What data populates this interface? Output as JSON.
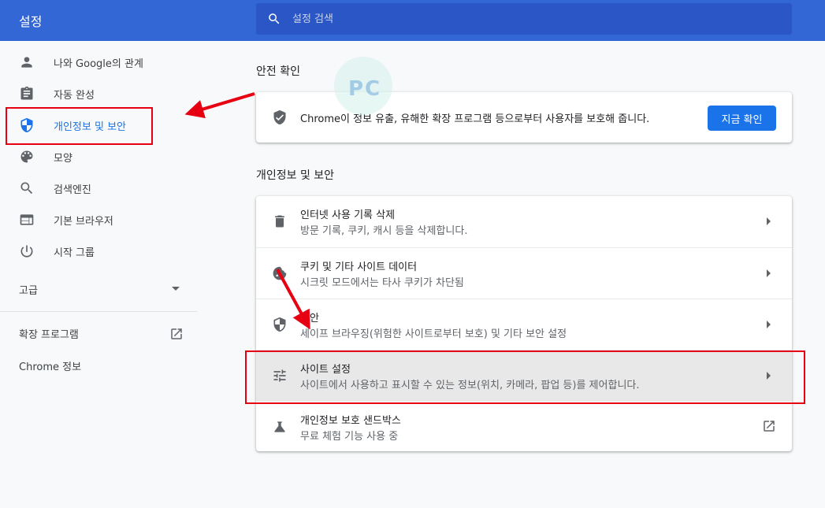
{
  "header": {
    "title": "설정",
    "search_placeholder": "설정 검색"
  },
  "sidebar": {
    "items": [
      {
        "label": "나와 Google의 관계",
        "icon": "person-icon"
      },
      {
        "label": "자동 완성",
        "icon": "clipboard-icon"
      },
      {
        "label": "개인정보 및 보안",
        "icon": "shield-icon",
        "active": true
      },
      {
        "label": "모양",
        "icon": "palette-icon"
      },
      {
        "label": "검색엔진",
        "icon": "search-icon"
      },
      {
        "label": "기본 브라우저",
        "icon": "browser-icon"
      },
      {
        "label": "시작 그룹",
        "icon": "power-icon"
      }
    ],
    "advanced_label": "고급",
    "extensions_label": "확장 프로그램",
    "about_label": "Chrome 정보"
  },
  "safety_check": {
    "section_title": "안전 확인",
    "description": "Chrome이 정보 유출, 유해한 확장 프로그램 등으로부터 사용자를 보호해 줍니다.",
    "button_label": "지금 확인"
  },
  "privacy": {
    "section_title": "개인정보 및 보안",
    "rows": [
      {
        "title": "인터넷 사용 기록 삭제",
        "subtitle": "방문 기록, 쿠키, 캐시 등을 삭제합니다.",
        "icon": "trash-icon"
      },
      {
        "title": "쿠키 및 기타 사이트 데이터",
        "subtitle": "시크릿 모드에서는 타사 쿠키가 차단됨",
        "icon": "cookie-icon"
      },
      {
        "title": "보안",
        "subtitle": "세이프 브라우징(위험한 사이트로부터 보호) 및 기타 보안 설정",
        "icon": "shield-icon"
      },
      {
        "title": "사이트 설정",
        "subtitle": "사이트에서 사용하고 표시할 수 있는 정보(위치, 카메라, 팝업 등)를 제어합니다.",
        "icon": "sliders-icon"
      },
      {
        "title": "개인정보 보호 샌드박스",
        "subtitle": "무료 체험 기능 사용 중",
        "icon": "flask-icon"
      }
    ]
  },
  "colors": {
    "header_bg": "#3367d6",
    "search_bg": "#2a56c6",
    "accent": "#1a73e8",
    "annotation_red": "#e60012"
  }
}
